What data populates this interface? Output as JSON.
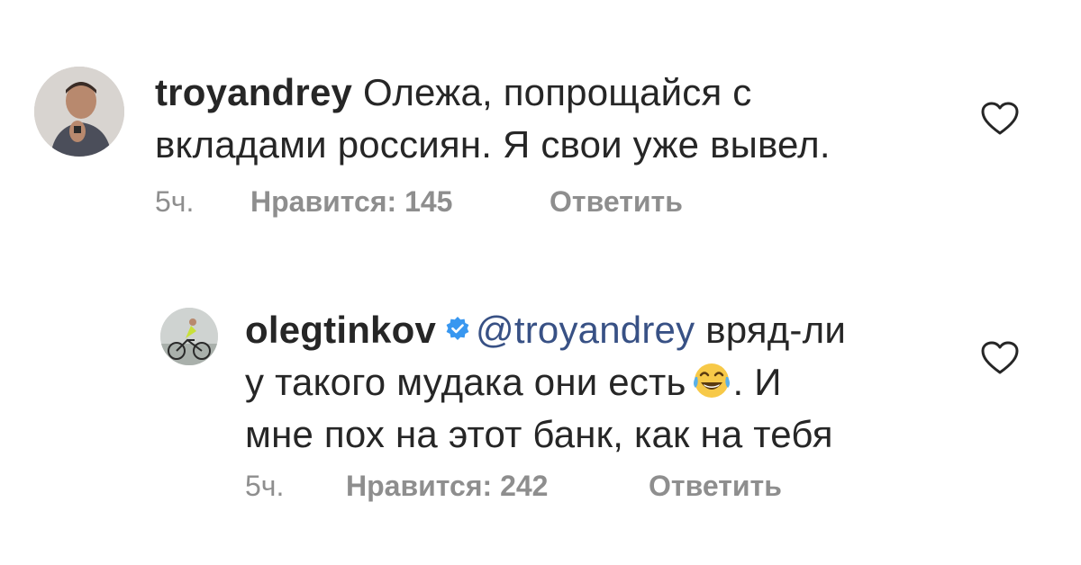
{
  "comments": [
    {
      "username": "troyandrey",
      "text_line1": "Олежа, попрощайся с",
      "text_line2": "вкладами россиян. Я свои уже вывел.",
      "time": "5ч.",
      "likes": "Нравится: 145",
      "reply": "Ответить",
      "avatar_icon": "user-avatar-photo",
      "like_icon": "heart-outline-icon"
    },
    {
      "username": "olegtinkov",
      "verified": true,
      "mention": "@troyandrey",
      "text_line1_tail": "вряд-ли",
      "text_line2": "у такого мудака они есть",
      "text_line2_tail": ". И",
      "text_line3": "мне пох на этот банк, как на тебя",
      "emoji": "face-with-tears-of-joy",
      "time": "5ч.",
      "likes": "Нравится: 242",
      "reply": "Ответить",
      "avatar_icon": "cyclist-avatar-photo",
      "like_icon": "heart-outline-icon"
    }
  ],
  "colors": {
    "text": "#262626",
    "meta": "#8e8e8e",
    "mention": "#385185",
    "verified": "#3897f0"
  }
}
